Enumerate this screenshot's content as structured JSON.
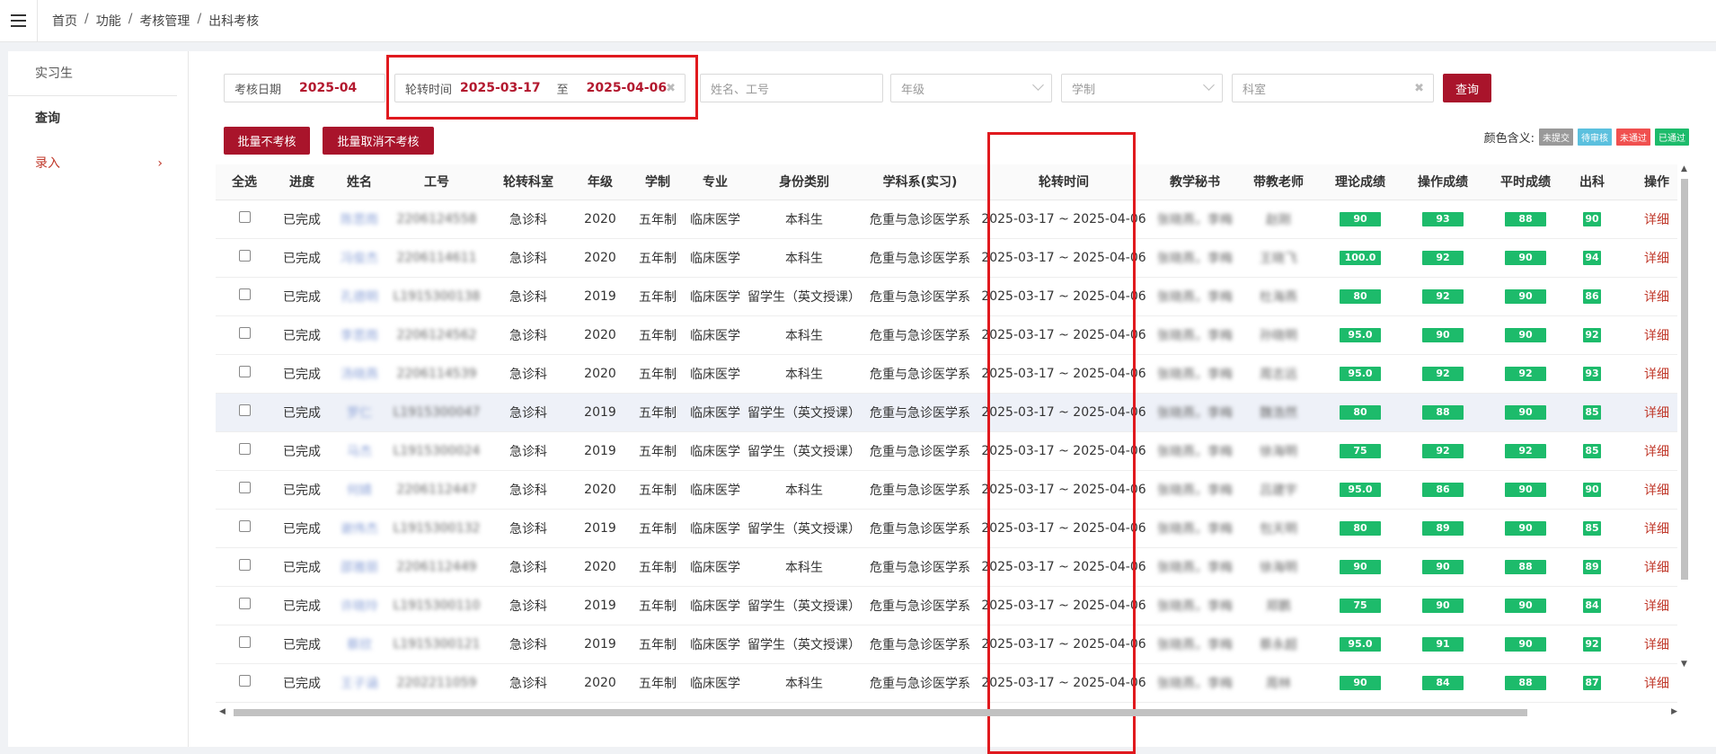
{
  "breadcrumb": [
    "首页",
    "功能",
    "考核管理",
    "出科考核"
  ],
  "sidebar": {
    "title": "实习生",
    "items": [
      {
        "label": "查询",
        "arrow": ""
      },
      {
        "label": "录入",
        "arrow": "›"
      }
    ]
  },
  "filters": {
    "exam_date_label": "考核日期",
    "exam_date_value": "2025-04",
    "rotation_label": "轮转时间",
    "rotation_start": "2025-03-17",
    "rotation_to": "至",
    "rotation_end": "2025-04-06",
    "name_placeholder": "姓名、工号",
    "grade_placeholder": "年级",
    "system_placeholder": "学制",
    "dept_placeholder": "科室",
    "query_button": "查询"
  },
  "actions": {
    "batch_no_exam": "批量不考核",
    "batch_cancel": "批量取消不考核"
  },
  "legend": {
    "label": "颜色含义:",
    "items": [
      {
        "text": "未提交",
        "color": "#999999"
      },
      {
        "text": "待审核",
        "color": "#5bc0de"
      },
      {
        "text": "未通过",
        "color": "#f0504f"
      },
      {
        "text": "已通过",
        "color": "#1dbb6b"
      }
    ]
  },
  "table": {
    "headers": [
      "全选",
      "进度",
      "姓名",
      "工号",
      "轮转科室",
      "年级",
      "学制",
      "专业",
      "身份类别",
      "学科系(实习)",
      "轮转时间",
      "教学秘书",
      "带教老师",
      "理论成绩",
      "操作成绩",
      "平时成绩",
      "出科",
      "操作"
    ],
    "rows": [
      {
        "progress": "已完成",
        "name": "陈思雨",
        "id": "2206124558",
        "dept": "急诊科",
        "grade": "2020",
        "system": "五年制",
        "major": "临床医学",
        "type": "本科生",
        "discipline": "危重与急诊医学系",
        "time": "2025-03-17 ~ 2025-04-06",
        "secretary": "张晓燕，李梅",
        "teacher": "赵刚",
        "theory": "90",
        "op": "93",
        "usual": "88",
        "out": "90",
        "action": "详细"
      },
      {
        "progress": "已完成",
        "name": "冯俊杰",
        "id": "2206114611",
        "dept": "急诊科",
        "grade": "2020",
        "system": "五年制",
        "major": "临床医学",
        "type": "本科生",
        "discipline": "危重与急诊医学系",
        "time": "2025-03-17 ~ 2025-04-06",
        "secretary": "张晓燕，李梅",
        "teacher": "王晓飞",
        "theory": "100.0",
        "op": "92",
        "usual": "90",
        "out": "94",
        "action": "详细"
      },
      {
        "progress": "已完成",
        "name": "孔德明",
        "id": "L1915300138",
        "dept": "急诊科",
        "grade": "2019",
        "system": "五年制",
        "major": "临床医学",
        "type": "留学生（英文授课）",
        "discipline": "危重与急诊医学系",
        "time": "2025-03-17 ~ 2025-04-06",
        "secretary": "张晓燕，李梅",
        "teacher": "杜海燕",
        "theory": "80",
        "op": "92",
        "usual": "90",
        "out": "86",
        "action": "详细"
      },
      {
        "progress": "已完成",
        "name": "李思雨",
        "id": "2206124562",
        "dept": "急诊科",
        "grade": "2020",
        "system": "五年制",
        "major": "临床医学",
        "type": "本科生",
        "discipline": "危重与急诊医学系",
        "time": "2025-03-17 ~ 2025-04-06",
        "secretary": "张晓燕，李梅",
        "teacher": "孙晓明",
        "theory": "95.0",
        "op": "90",
        "usual": "90",
        "out": "92",
        "action": "详细"
      },
      {
        "progress": "已完成",
        "name": "汤晓燕",
        "id": "2206114539",
        "dept": "急诊科",
        "grade": "2020",
        "system": "五年制",
        "major": "临床医学",
        "type": "本科生",
        "discipline": "危重与急诊医学系",
        "time": "2025-03-17 ~ 2025-04-06",
        "secretary": "张晓燕，李梅",
        "teacher": "周志远",
        "theory": "95.0",
        "op": "92",
        "usual": "92",
        "out": "93",
        "action": "详细"
      },
      {
        "progress": "已完成",
        "name": "罗仁",
        "id": "L1915300047",
        "dept": "急诊科",
        "grade": "2019",
        "system": "五年制",
        "major": "临床医学",
        "type": "留学生（英文授课）",
        "discipline": "危重与急诊医学系",
        "time": "2025-03-17 ~ 2025-04-06",
        "secretary": "张晓燕，李梅",
        "teacher": "魏浩然",
        "theory": "80",
        "op": "88",
        "usual": "90",
        "out": "85",
        "action": "详细"
      },
      {
        "progress": "已完成",
        "name": "马杰",
        "id": "L1915300024",
        "dept": "急诊科",
        "grade": "2019",
        "system": "五年制",
        "major": "临床医学",
        "type": "留学生（英文授课）",
        "discipline": "危重与急诊医学系",
        "time": "2025-03-17 ~ 2025-04-06",
        "secretary": "张晓燕，李梅",
        "teacher": "徐海明",
        "theory": "75",
        "op": "92",
        "usual": "92",
        "out": "85",
        "action": "详细"
      },
      {
        "progress": "已完成",
        "name": "何婧",
        "id": "2206112447",
        "dept": "急诊科",
        "grade": "2020",
        "system": "五年制",
        "major": "临床医学",
        "type": "本科生",
        "discipline": "危重与急诊医学系",
        "time": "2025-03-17 ~ 2025-04-06",
        "secretary": "张晓燕，李梅",
        "teacher": "吕建宇",
        "theory": "95.0",
        "op": "86",
        "usual": "90",
        "out": "90",
        "action": "详细"
      },
      {
        "progress": "已完成",
        "name": "谢伟杰",
        "id": "L1915300132",
        "dept": "急诊科",
        "grade": "2019",
        "system": "五年制",
        "major": "临床医学",
        "type": "留学生（英文授课）",
        "discipline": "危重与急诊医学系",
        "time": "2025-03-17 ~ 2025-04-06",
        "secretary": "张晓燕，李梅",
        "teacher": "包天明",
        "theory": "80",
        "op": "89",
        "usual": "90",
        "out": "85",
        "action": "详细"
      },
      {
        "progress": "已完成",
        "name": "邵雅丽",
        "id": "2206112449",
        "dept": "急诊科",
        "grade": "2020",
        "system": "五年制",
        "major": "临床医学",
        "type": "本科生",
        "discipline": "危重与急诊医学系",
        "time": "2025-03-17 ~ 2025-04-06",
        "secretary": "张晓燕，李梅",
        "teacher": "徐海明",
        "theory": "90",
        "op": "90",
        "usual": "88",
        "out": "89",
        "action": "详细"
      },
      {
        "progress": "已完成",
        "name": "许晓玲",
        "id": "L1915300110",
        "dept": "急诊科",
        "grade": "2019",
        "system": "五年制",
        "major": "临床医学",
        "type": "留学生（英文授课）",
        "discipline": "危重与急诊医学系",
        "time": "2025-03-17 ~ 2025-04-06",
        "secretary": "张晓燕，李梅",
        "teacher": "郑鹏",
        "theory": "75",
        "op": "90",
        "usual": "90",
        "out": "84",
        "action": "详细"
      },
      {
        "progress": "已完成",
        "name": "蔡欣",
        "id": "L1915300121",
        "dept": "急诊科",
        "grade": "2019",
        "system": "五年制",
        "major": "临床医学",
        "type": "留学生（英文授课）",
        "discipline": "危重与急诊医学系",
        "time": "2025-03-17 ~ 2025-04-06",
        "secretary": "张晓燕，李梅",
        "teacher": "蔡永超",
        "theory": "95.0",
        "op": "91",
        "usual": "90",
        "out": "92",
        "action": "详细"
      },
      {
        "progress": "已完成",
        "name": "王子涵",
        "id": "2202211059",
        "dept": "急诊科",
        "grade": "2020",
        "system": "五年制",
        "major": "临床医学",
        "type": "本科生",
        "discipline": "危重与急诊医学系",
        "time": "2025-03-17 ~ 2025-04-06",
        "secretary": "张晓燕，李梅",
        "teacher": "周林",
        "theory": "90",
        "op": "84",
        "usual": "88",
        "out": "87",
        "action": "详细"
      }
    ]
  }
}
